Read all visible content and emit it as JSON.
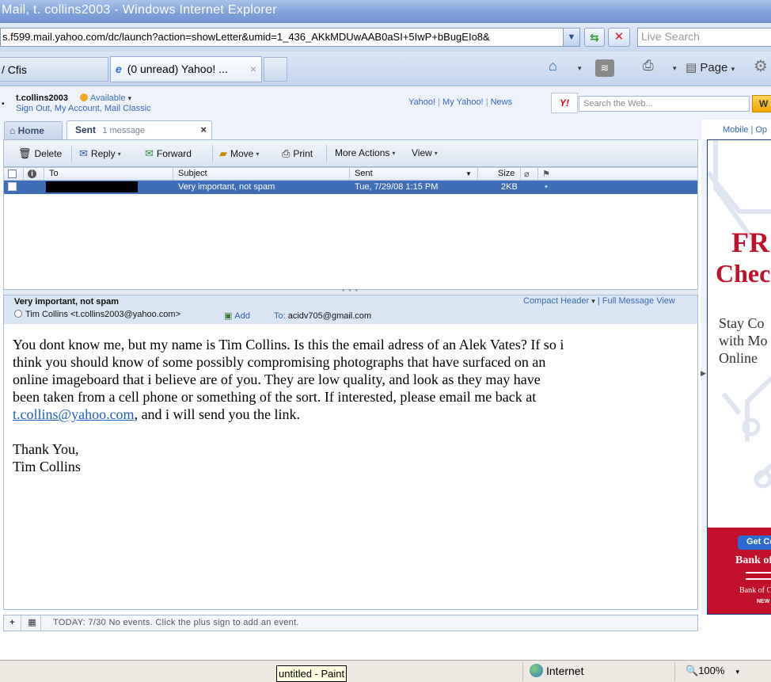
{
  "window": {
    "title": "Mail, t. collins2003 - Windows Internet Explorer"
  },
  "browser": {
    "address": "s.f599.mail.yahoo.com/dc/launch?action=showLetter&umid=1_436_AKkMDUwAAB0aSI+5IwP+bBugEIo8&",
    "search_placeholder": "Live Search",
    "tabs": [
      {
        "label": "/ Cfis"
      },
      {
        "label": "(0 unread) Yahoo! ...",
        "close": "×"
      }
    ],
    "page_menu": "Page",
    "caret": "▾",
    "caret_small": "▾"
  },
  "yahoo_header": {
    "username": "t.collins2003",
    "status": "Available",
    "links": "Sign Out,  My Account,  Mail Classic",
    "nav": [
      "Yahoo!",
      "My Yahoo!",
      "News"
    ],
    "nav_sep": "|",
    "search_placeholder": "Search the Web...",
    "search_button": "W",
    "logo": "Y!"
  },
  "mail_tabs": {
    "home": "Home",
    "sent": "Sent",
    "sent_count": "1 message",
    "close": "×",
    "mobile": "Mobile  |  Op"
  },
  "toolbar": {
    "delete": "Delete",
    "reply": "Reply",
    "forward": "Forward",
    "move": "Move",
    "print": "Print",
    "more_actions": "More Actions",
    "view": "View"
  },
  "list": {
    "columns": {
      "to": "To",
      "subject": "Subject",
      "sent": "Sent",
      "size": "Size",
      "info": "i"
    },
    "rows": [
      {
        "subject": "Very important, not spam",
        "sent": "Tue, 7/29/08 1:15 PM",
        "size": "2KB",
        "dot": "•"
      }
    ],
    "splitter": "• • •"
  },
  "message": {
    "subject": "Very important, not spam",
    "from": "Tim Collins <t.collins2003@yahoo.com>",
    "add": "Add",
    "to_label": "To:",
    "to": "acidv705@gmail.com",
    "compact_header": "Compact Header",
    "full_view": "| Full Message View",
    "body_lines": [
      "You dont know me, but my name is Tim Collins. Is this the email adress of an Alek Vates? If so i",
      "think you should know of some possibly compromising photographs that have surfaced on an",
      "online imageboard that i believe are of you. They are low quality, and look as they may have",
      "been taken from a cell phone or something of the sort. If interested, please email me back at"
    ],
    "link": "t.collins@yahoo.com",
    "link_tail": ", and i will send you the link.",
    "signoff": [
      "Thank You,",
      "Tim Collins"
    ]
  },
  "calendar": {
    "text": "TODAY: 7/30   No events. Click the plus sign to add an event.",
    "plus": "+"
  },
  "ad": {
    "headline1": "FR",
    "headline2": "Chec",
    "body": [
      "Stay Co",
      "with Mo",
      "Online"
    ],
    "button": "Get Co",
    "brand": "Bank of",
    "small": "Bank of C",
    "tiny": "NEW"
  },
  "statusbar": {
    "taskbar_tooltip": "untitled - Paint",
    "zone": "Internet",
    "zoom": "100%"
  },
  "colors": {
    "selection": "#3e6eb5",
    "link": "#3667b8",
    "ad_red": "#c0102a"
  }
}
